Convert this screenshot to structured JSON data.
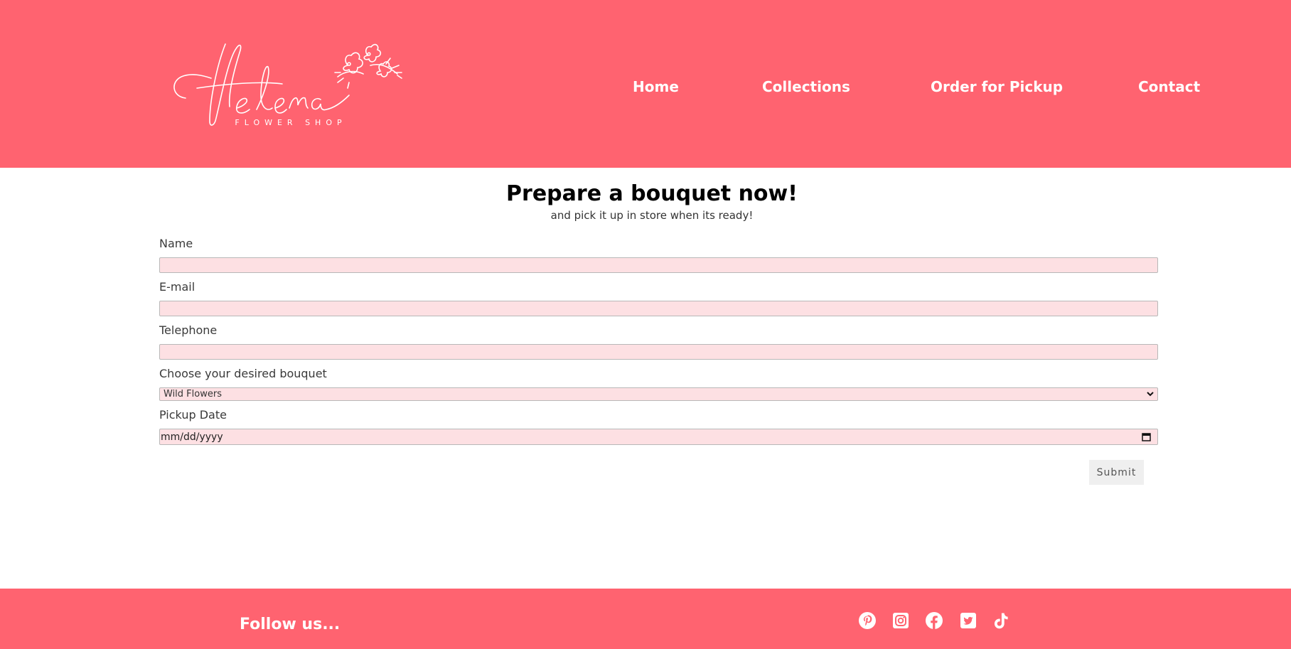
{
  "brand": {
    "logo_script": "Helena",
    "logo_tagline": "FLOWER SHOP",
    "color": "#ff6370"
  },
  "nav": {
    "items": [
      {
        "label": "Home"
      },
      {
        "label": "Collections"
      },
      {
        "label": "Order for Pickup"
      },
      {
        "label": "Contact"
      }
    ]
  },
  "main": {
    "title": "Prepare a bouquet now!",
    "subtitle": "and pick it up in store when its ready!"
  },
  "form": {
    "name_label": "Name",
    "name_value": "",
    "email_label": "E-mail",
    "email_value": "",
    "telephone_label": "Telephone",
    "telephone_value": "",
    "bouquet_label": "Choose your desired bouquet",
    "bouquet_selected": "Wild Flowers",
    "pickup_label": "Pickup Date",
    "pickup_placeholder": "mm/dd/yyyy",
    "submit_label": "Submit",
    "field_color": "#fde0e3"
  },
  "footer": {
    "follow_label": "Follow us...",
    "socials": [
      {
        "icon": "pinterest-icon"
      },
      {
        "icon": "instagram-icon"
      },
      {
        "icon": "facebook-icon"
      },
      {
        "icon": "twitter-icon"
      },
      {
        "icon": "tiktok-icon"
      }
    ]
  }
}
